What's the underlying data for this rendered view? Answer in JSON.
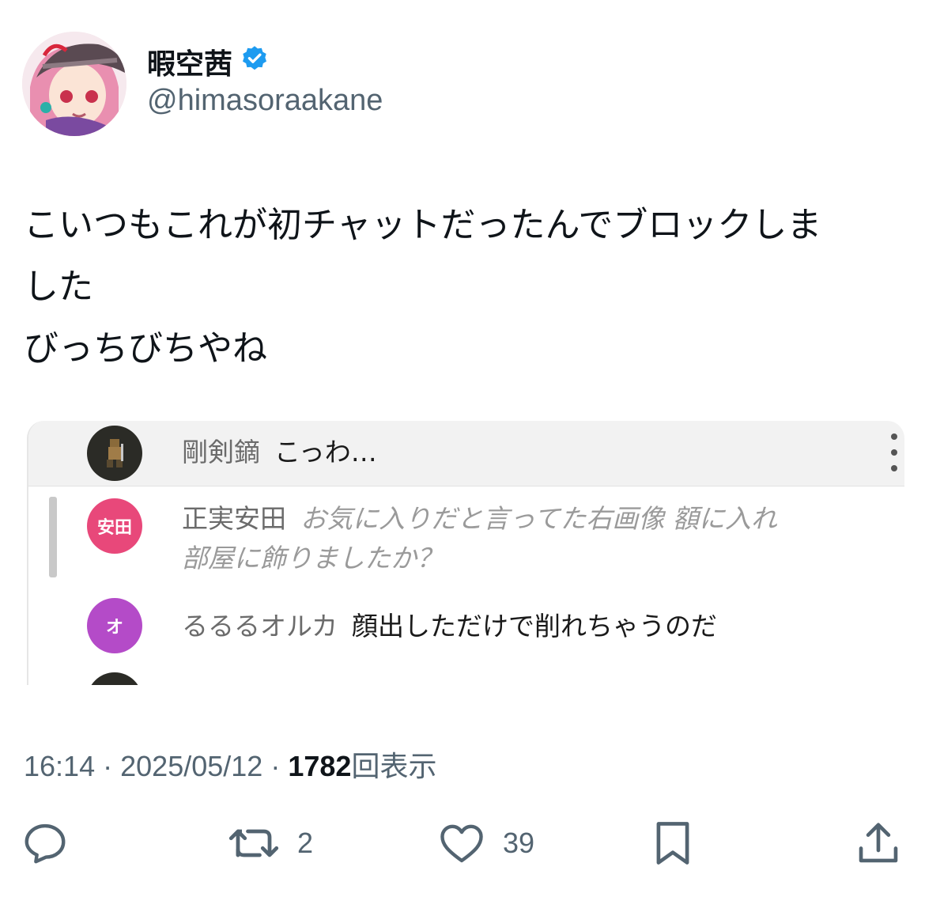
{
  "author": {
    "display_name": "暇空茜",
    "handle": "@himasoraakane",
    "verified_badge_icon": "verified-badge-icon",
    "badge_color": "#1d9bf0"
  },
  "tweet": {
    "lines": [
      "こいつもこれが初チャットだったんでブロックしま",
      "した",
      "びっちびちやね"
    ]
  },
  "embed": {
    "pinned": {
      "author": "剛剣鏑",
      "message": "こっわ…"
    },
    "messages": [
      {
        "avatar_label": "安田",
        "avatar_color": "#e8487a",
        "author": "正実安田",
        "message_line1": "お気に入りだと言ってた右画像 額に入れ",
        "message_line2": "部屋に飾りましたか？"
      },
      {
        "avatar_label": "オ",
        "avatar_color": "#b44bc8",
        "author": "るるるオルカ",
        "message_line1": "顔出しただけで削れちゃうのだ"
      }
    ]
  },
  "meta": {
    "time": "16:14",
    "date": "2025/05/12",
    "separator": "·",
    "views_count": "1782",
    "views_label": "回表示"
  },
  "actions": {
    "reply_count": "",
    "retweet_count": "2",
    "like_count": "39"
  }
}
